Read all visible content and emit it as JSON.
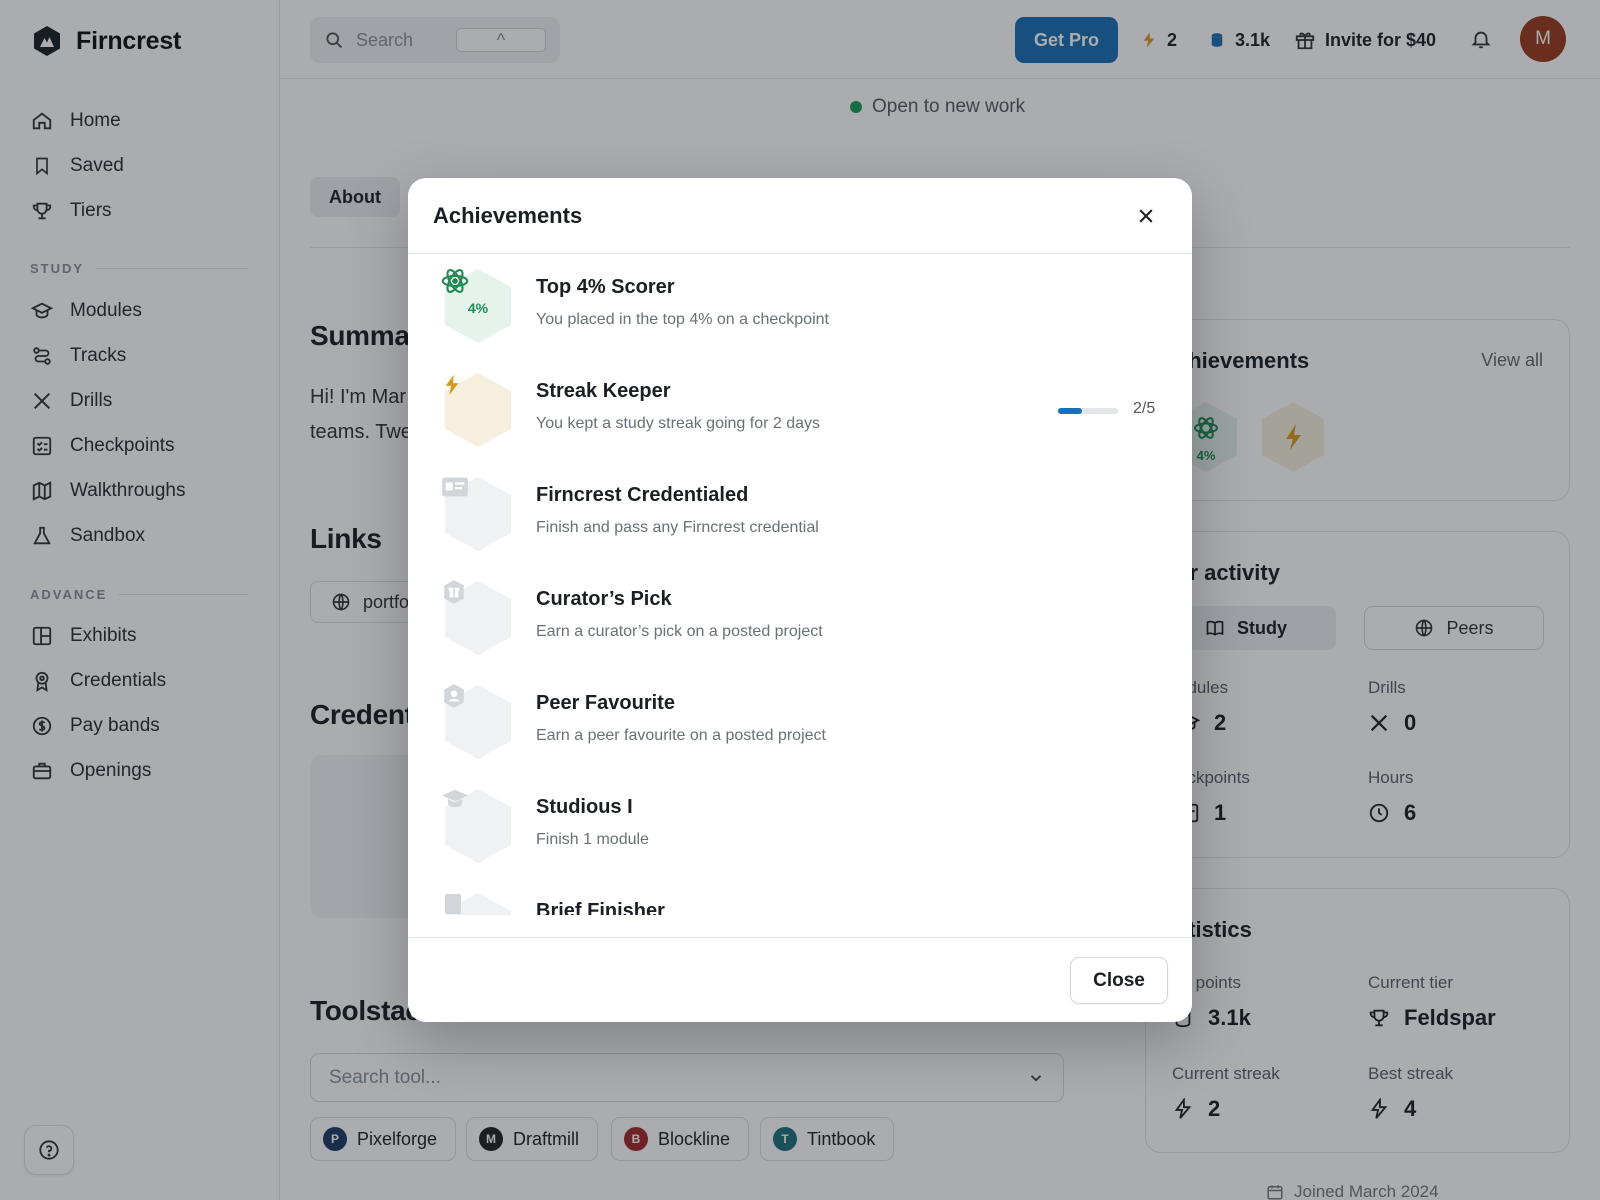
{
  "app": {
    "brand": "Firncrest"
  },
  "sidebar": {
    "primary": [
      {
        "label": "Home",
        "icon": "home-icon"
      },
      {
        "label": "Saved",
        "icon": "bookmark-icon"
      },
      {
        "label": "Tiers",
        "icon": "trophy-icon"
      }
    ],
    "study_heading": "STUDY",
    "study": [
      {
        "label": "Modules",
        "icon": "graduation-cap-icon"
      },
      {
        "label": "Tracks",
        "icon": "route-icon"
      },
      {
        "label": "Drills",
        "icon": "x-icon"
      },
      {
        "label": "Checkpoints",
        "icon": "checklist-icon"
      },
      {
        "label": "Walkthroughs",
        "icon": "map-icon"
      },
      {
        "label": "Sandbox",
        "icon": "flask-icon"
      }
    ],
    "advance_heading": "ADVANCE",
    "advance": [
      {
        "label": "Exhibits",
        "icon": "layout-icon"
      },
      {
        "label": "Credentials",
        "icon": "award-icon"
      },
      {
        "label": "Pay bands",
        "icon": "dollar-icon"
      },
      {
        "label": "Openings",
        "icon": "briefcase-icon"
      }
    ]
  },
  "topbar": {
    "search_placeholder": "Search",
    "search_shortcut": "^",
    "get_pro": "Get Pro",
    "streak_count": "2",
    "points": "3.1k",
    "invite": "Invite for $40",
    "avatar_initial": "M"
  },
  "profile": {
    "status": "Open to new work",
    "tab_about": "About",
    "summary_heading": "Summar",
    "bio_line1": "Hi! I'm Mar",
    "bio_line2": "teams. Twe",
    "links_heading": "Links",
    "link_label": "portfo",
    "credentials_heading": "Credent",
    "toolstack_heading": "Toolstac",
    "tool_search_placeholder": "Search tool...",
    "tools": [
      {
        "name": "Pixelforge",
        "color": "#1f3b63",
        "glyph": "P"
      },
      {
        "name": "Draftmill",
        "color": "#222222",
        "glyph": "M"
      },
      {
        "name": "Blockline",
        "color": "#a42a2a",
        "glyph": "B"
      },
      {
        "name": "Tintbook",
        "color": "#1d6f7a",
        "glyph": "T"
      }
    ],
    "joined": "Joined March 2024"
  },
  "right": {
    "achievements_title": "chievements",
    "view_all": "View all",
    "mini_badge_pct": "4%",
    "activity_title": "ur activity",
    "activity_tab_study": "Study",
    "activity_tab_peers": "Peers",
    "activity": [
      {
        "label": "odules",
        "value": "2"
      },
      {
        "label": "Drills",
        "value": "0"
      },
      {
        "label": "eckpoints",
        "value": "1"
      },
      {
        "label": "Hours",
        "value": "6"
      }
    ],
    "statistics_title": "atistics",
    "statistics": [
      {
        "label": "aft points",
        "value": "3.1k"
      },
      {
        "label": "Current tier",
        "value": "Feldspar"
      },
      {
        "label": "Current streak",
        "value": "2"
      },
      {
        "label": "Best streak",
        "value": "4"
      }
    ]
  },
  "modal": {
    "title": "Achievements",
    "close_label": "Close",
    "items": [
      {
        "title": "Top 4% Scorer",
        "desc": "You placed in the top 4% on a checkpoint",
        "badge": "4%",
        "icon": "atom-icon",
        "earned": true
      },
      {
        "title": "Streak Keeper",
        "desc": "You kept a study streak going for 2 days",
        "icon": "bolt-icon",
        "progress_text": "2/5",
        "progress": 0.4
      },
      {
        "title": "Firncrest Credentialed",
        "desc": "Finish and pass any Firncrest credential",
        "icon": "id-card-icon"
      },
      {
        "title": "Curator’s Pick",
        "desc": "Earn a curator’s pick on a posted project",
        "icon": "gift-icon"
      },
      {
        "title": "Peer Favourite",
        "desc": "Earn a peer favourite on a posted project",
        "icon": "user-icon"
      },
      {
        "title": "Studious I",
        "desc": "Finish 1 module",
        "icon": "graduation-cap-icon"
      },
      {
        "title": "Brief Finisher",
        "desc": "",
        "icon": "document-icon"
      }
    ]
  },
  "colors": {
    "accent": "#1a6fb5",
    "success": "#1f9d55",
    "streak": "#d99a1c",
    "avatar": "#9a3b1d"
  }
}
